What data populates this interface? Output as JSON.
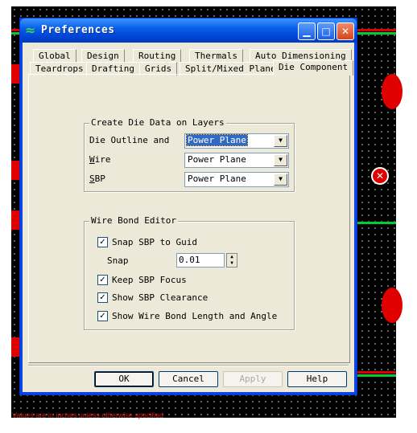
{
  "window": {
    "title": "Preferences"
  },
  "tabs_row1": [
    "Global",
    "Design",
    "Routing",
    "Thermals",
    "Auto Dimensioning"
  ],
  "tabs_row2": [
    "Teardrops",
    "Drafting",
    "Grids",
    "Split/Mixed Plane",
    "Die Component"
  ],
  "active_tab": "Die Component",
  "die_data": {
    "group_title": "Create Die Data on Layers",
    "outline_label": "Die Outline and",
    "outline_value": "Power Plane",
    "wire_label": "Wire",
    "wire_value": "Power Plane",
    "sbp_label": "SBP",
    "sbp_value": "Power Plane"
  },
  "wire_bond": {
    "group_title": "Wire Bond Editor",
    "snap_sbp_label": "Snap SBP to Guid",
    "snap_sbp_checked": true,
    "snap_label": "Snap",
    "snap_value": "0.01",
    "keep_focus_label": "Keep SBP Focus",
    "keep_focus_checked": true,
    "show_clearance_label": "Show SBP Clearance",
    "show_clearance_checked": true,
    "show_length_label": "Show Wire Bond Length and Angle",
    "show_length_checked": true
  },
  "buttons": {
    "ok": "OK",
    "cancel": "Cancel",
    "apply": "Apply",
    "help": "Help"
  },
  "status": "Values are in inches unless otherwise specified",
  "colors": {
    "title_blue": "#0a5fe8",
    "dialog_bg": "#ece9d8",
    "cad_red": "#e00000",
    "cad_green": "#00cc33"
  }
}
